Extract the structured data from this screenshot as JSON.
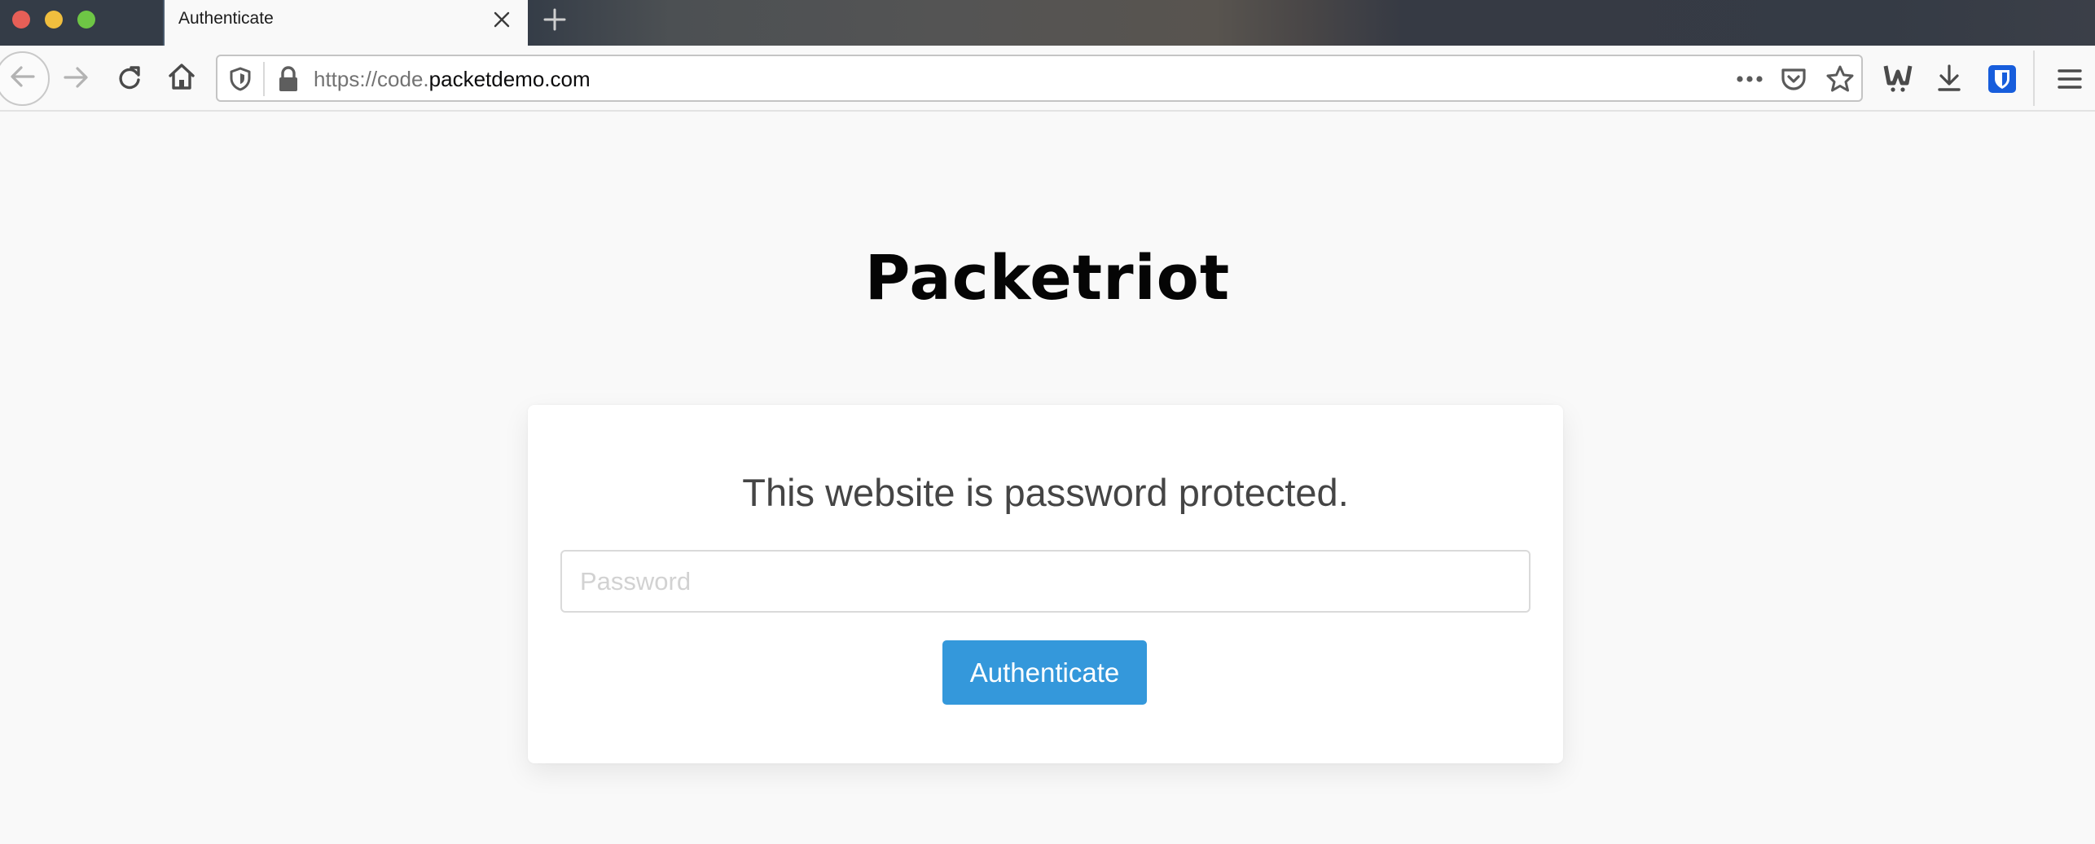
{
  "browser": {
    "tabs": [
      {
        "title": "Authenticate",
        "active": true
      }
    ],
    "new_tab_icon": "plus-icon",
    "close_tab_icon": "close-icon",
    "window_controls": [
      "close",
      "minimize",
      "zoom"
    ],
    "nav": {
      "back_icon": "arrow-left-icon",
      "forward_icon": "arrow-right-icon",
      "reload_icon": "reload-icon",
      "home_icon": "home-icon"
    },
    "url": {
      "scheme_and_subdomain": "https://code.",
      "domain": "packetdemo.com"
    },
    "url_bar_icons": [
      "tracking-protection-shield-icon",
      "lock-icon",
      "page-actions-dots-icon",
      "pocket-icon",
      "bookmark-star-icon"
    ],
    "toolbar_icons": [
      "wappalyzer-icon",
      "download-icon",
      "bitwarden-icon",
      "hamburger-menu-icon"
    ],
    "colors": {
      "bitwarden_blue": "#175ddc"
    }
  },
  "page": {
    "title": "Packetriot",
    "message": "This website is password protected.",
    "password_placeholder": "Password",
    "password_value": "",
    "button_label": "Authenticate",
    "colors": {
      "button": "#3498db",
      "background": "#f9f9f9",
      "card": "#ffffff"
    }
  }
}
